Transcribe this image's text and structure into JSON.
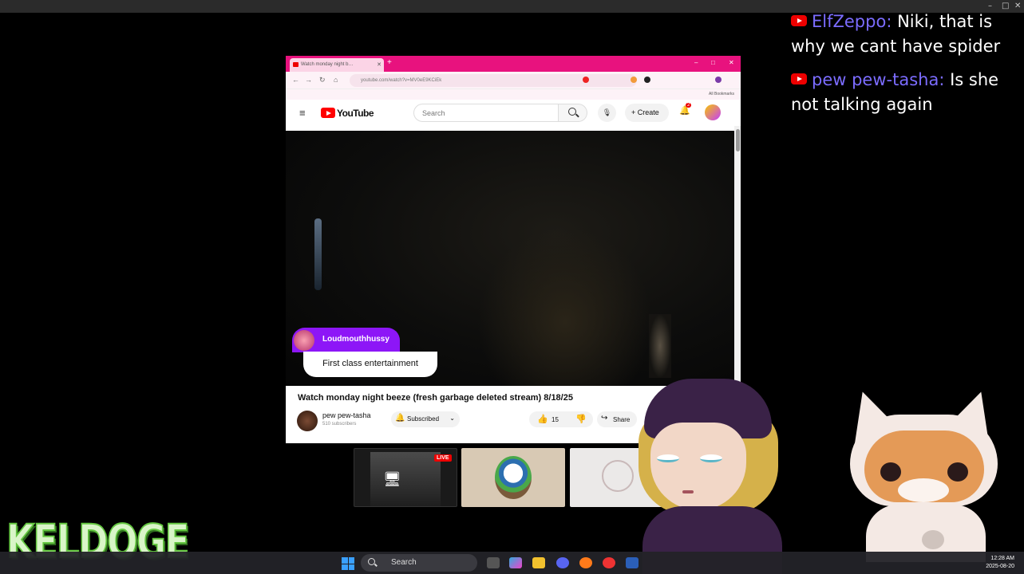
{
  "window": {
    "min": "–",
    "max": "□",
    "close": "✕"
  },
  "chat": {
    "messages": [
      {
        "user": "ElfZeppo",
        "text": "Niki, that is why we cant have spider"
      },
      {
        "user": "pew pew-tasha",
        "text": "Is she not talking again"
      }
    ]
  },
  "browser": {
    "tab_title": "Watch monday night b…",
    "url": "youtube.com/watch?v=MV0eE9KCiEk",
    "bookmarks_label": "All Bookmarks",
    "search_placeholder": "Search",
    "logo_text": "YouTube",
    "create_label": "Create",
    "notif_count": "2"
  },
  "superchat": {
    "name": "Loudmouthhussy",
    "message": "First class entertainment"
  },
  "video": {
    "title": "Watch monday night beeze (fresh garbage deleted stream) 8/18/25",
    "channel": "pew pew-tasha",
    "subscribers": "510 subscribers",
    "subscribed_label": "Subscribed",
    "likes": "15",
    "share_label": "Share"
  },
  "thumbnails": {
    "live_badge": "LIVE"
  },
  "streamer_logo": "KELDOGE",
  "taskbar": {
    "search": "Search",
    "time": "12:28 AM",
    "date": "2025-08-20"
  },
  "colors": {
    "chat_username": "#7b6cff",
    "tab_bar": "#e8127e",
    "superchat": "#8d16f7",
    "logo": "#64c740"
  }
}
